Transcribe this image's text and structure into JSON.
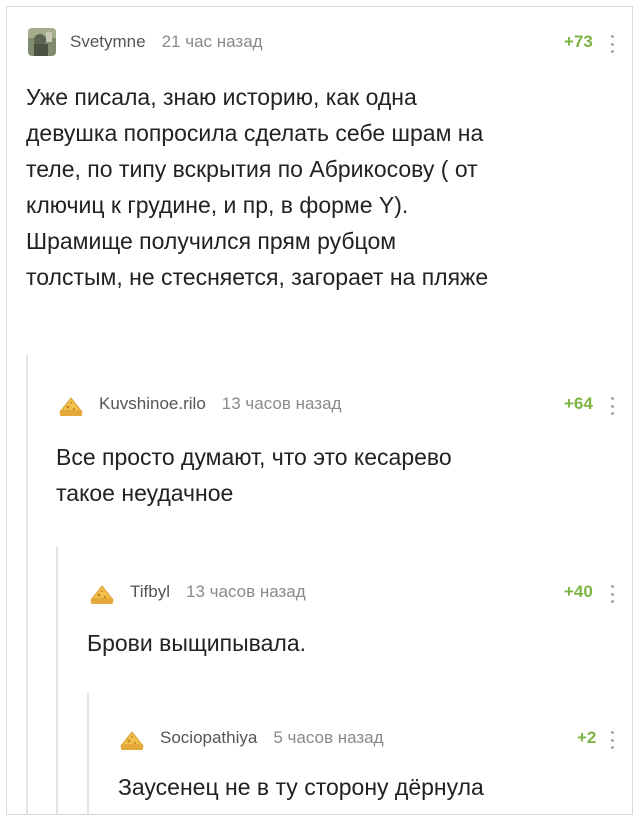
{
  "comments": [
    {
      "username": "Svetymne",
      "time": "21 час назад",
      "rating": "+73",
      "lines": [
        "Уже писала, знаю историю, как одна",
        "девушка попросила сделать себе шрам на",
        "теле, по типу вскрытия по Абрикосову ( от",
        "ключиц к грудине, и пр, в форме Y).",
        "Шрамище получился прям рубцом",
        "толстым, не стесняется, загорает на пляже"
      ]
    },
    {
      "username": "Kuvshinoe.rilo",
      "time": "13 часов назад",
      "rating": "+64",
      "lines": [
        "Все просто думают, что это кесарево",
        "такое неудачное"
      ]
    },
    {
      "username": "Tifbyl",
      "time": "13 часов назад",
      "rating": "+40",
      "lines": [
        "Брови выщипывала."
      ]
    },
    {
      "username": "Sociopathiya",
      "time": "5 часов назад",
      "rating": "+2",
      "lines": [
        "Заусенец не в ту сторону дёрнула"
      ]
    }
  ],
  "colors": {
    "rating": "#7db443",
    "username": "#555555",
    "time": "#8a8a8a",
    "text": "#222222",
    "branch_line": "#e2e2e2"
  },
  "icons": {
    "avatar_first": "user-photo-avatar",
    "avatar_default": "default-pikabu-avatar-icon",
    "more": "more-vertical-icon"
  }
}
